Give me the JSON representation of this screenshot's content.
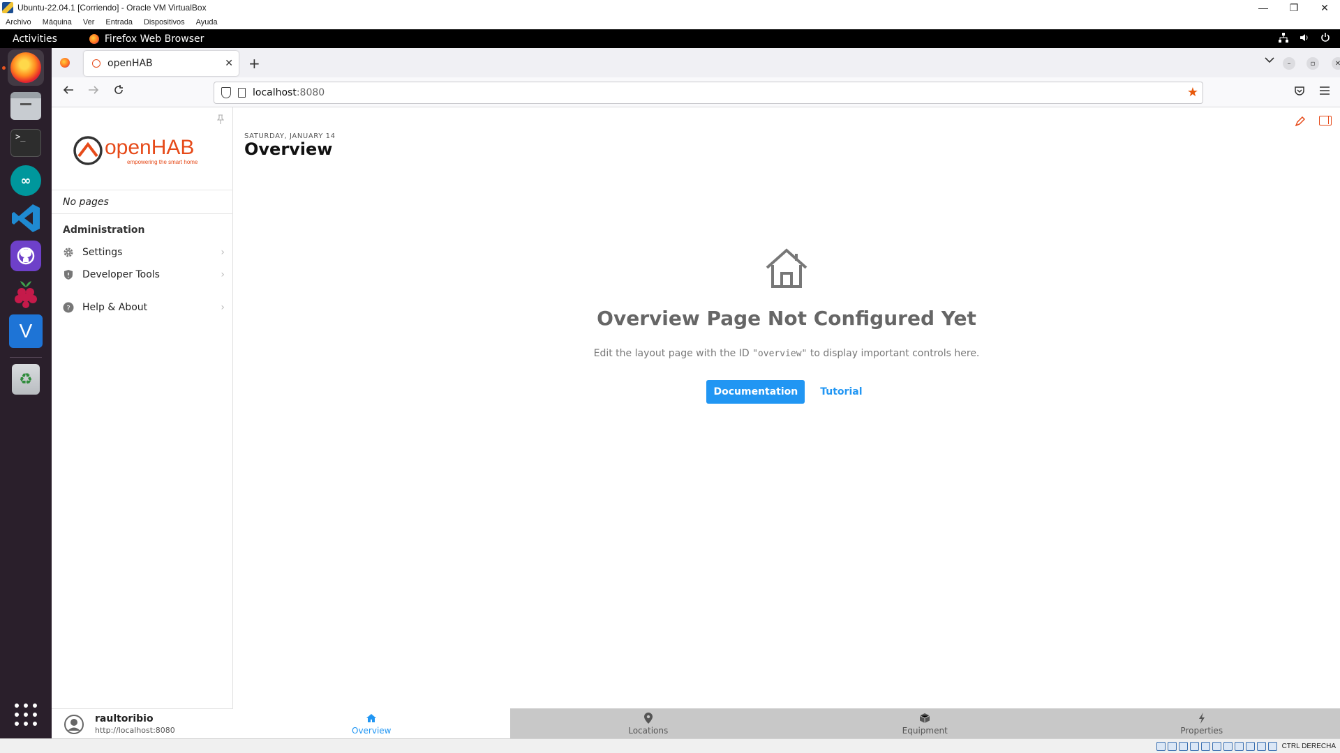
{
  "vbox": {
    "title": "Ubuntu-22.04.1 [Corriendo] - Oracle VM VirtualBox",
    "menu": [
      "Archivo",
      "Máquina",
      "Ver",
      "Entrada",
      "Dispositivos",
      "Ayuda"
    ],
    "host_key": "CTRL DERECHA"
  },
  "gnome": {
    "activities": "Activities",
    "app_name": "Firefox Web Browser"
  },
  "dock": {
    "items": [
      "firefox-icon",
      "files-icon",
      "terminal-icon",
      "arduino-icon",
      "vscode-icon",
      "github-desktop-icon",
      "raspberry-pi-icon",
      "vnc-viewer-icon",
      "trash-icon",
      "app-grid-icon"
    ]
  },
  "browser": {
    "tab_title": "openHAB",
    "url_host": "localhost",
    "url_port": ":8080"
  },
  "openhab": {
    "logo_text": "openHAB",
    "logo_tagline": "empowering the smart home",
    "no_pages": "No pages",
    "admin_title": "Administration",
    "sidebar_items": [
      {
        "label": "Settings",
        "icon": "gear-icon"
      },
      {
        "label": "Developer Tools",
        "icon": "shield-icon"
      },
      {
        "label": "Help & About",
        "icon": "help-icon"
      }
    ],
    "user": {
      "name": "raultoribio",
      "url": "http://localhost:8080"
    },
    "date": "SATURDAY, JANUARY 14",
    "page_title": "Overview",
    "empty_title": "Overview Page Not Configured Yet",
    "empty_desc_before": "Edit the layout page with the ID ",
    "empty_desc_code": "\"overview\"",
    "empty_desc_after": " to display important controls here.",
    "doc_button": "Documentation",
    "tutorial_button": "Tutorial",
    "tabs": [
      {
        "label": "Overview",
        "icon": "home-icon",
        "active": true
      },
      {
        "label": "Locations",
        "icon": "location-pin-icon",
        "active": false
      },
      {
        "label": "Equipment",
        "icon": "cube-icon",
        "active": false
      },
      {
        "label": "Properties",
        "icon": "bolt-icon",
        "active": false
      }
    ]
  },
  "colors": {
    "accent": "#2196f3",
    "brand": "#e64a19",
    "bookmark_star": "#e8590c"
  }
}
